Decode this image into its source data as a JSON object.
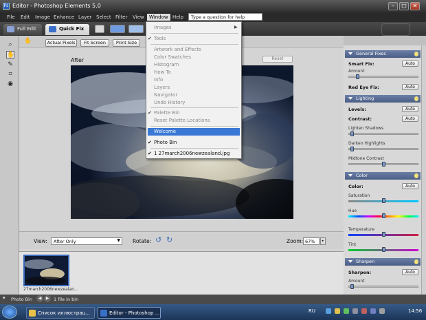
{
  "window": {
    "title": "Editor - Photoshop Elements 5.0",
    "controls": {
      "minimize": "–",
      "maximize": "□",
      "close": "✕"
    }
  },
  "menubar": {
    "items": [
      "File",
      "Edit",
      "Image",
      "Enhance",
      "Layer",
      "Select",
      "Filter",
      "View",
      "Window",
      "Help"
    ],
    "active": "Window",
    "help_placeholder": "Type a question for help"
  },
  "modes": {
    "full_edit": "Full Edit",
    "quick_fix": "Quick Fix",
    "active": "Quick Fix"
  },
  "options_bar": {
    "actual_pixels": "Actual Pixels",
    "fit_screen": "Fit Screen",
    "print_size": "Print Size"
  },
  "canvas": {
    "after_label": "After",
    "reset_label": "Reset"
  },
  "view_bar": {
    "view_label": "View:",
    "view_value": "After Only",
    "rotate_label": "Rotate:",
    "zoom_label": "Zoom:",
    "zoom_value": "67%"
  },
  "photo_bin": {
    "thumb_name": "27march2006newzealan...",
    "status_label": "Photo Bin",
    "status_count": "1 file in bin"
  },
  "window_menu": {
    "items": [
      {
        "label": "Images",
        "enabled": false,
        "checked": false,
        "submenu": true
      },
      {
        "label": "Tools",
        "enabled": false,
        "checked": true
      },
      {
        "label": "Artwork and Effects",
        "enabled": false,
        "checked": false
      },
      {
        "label": "Color Swatches",
        "enabled": false,
        "checked": false
      },
      {
        "label": "Histogram",
        "enabled": false,
        "checked": false
      },
      {
        "label": "How To",
        "enabled": false,
        "checked": false
      },
      {
        "label": "Info",
        "enabled": false,
        "checked": false
      },
      {
        "label": "Layers",
        "enabled": false,
        "checked": false
      },
      {
        "label": "Navigator",
        "enabled": false,
        "checked": false
      },
      {
        "label": "Undo History",
        "enabled": false,
        "checked": false
      },
      {
        "label": "Palette Bin",
        "enabled": false,
        "checked": true
      },
      {
        "label": "Reset Palette Locations",
        "enabled": false,
        "checked": false
      },
      {
        "label": "Welcome",
        "enabled": true,
        "checked": false,
        "highlighted": true
      },
      {
        "label": "Photo Bin",
        "enabled": true,
        "checked": true
      },
      {
        "label": "1 27march2006newzealand.jpg",
        "enabled": true,
        "checked": true
      }
    ]
  },
  "palette": {
    "general_fixes": {
      "title": "General Fixes",
      "smart_fix": "Smart Fix:",
      "amount": "Amount",
      "red_eye": "Red Eye Fix:",
      "auto": "Auto"
    },
    "lighting": {
      "title": "Lighting",
      "levels": "Levels:",
      "contrast": "Contrast:",
      "lighten_shadows": "Lighten Shadows",
      "darken_highlights": "Darken Highlights",
      "midtone_contrast": "Midtone Contrast",
      "auto": "Auto"
    },
    "color": {
      "title": "Color",
      "color": "Color:",
      "saturation": "Saturation",
      "hue": "Hue",
      "temperature": "Temperature",
      "tint": "Tint",
      "auto": "Auto"
    },
    "sharpen": {
      "title": "Sharpen",
      "sharpen": "Sharpen:",
      "amount": "Amount",
      "auto": "Auto"
    }
  },
  "taskbar": {
    "items": [
      "Список иллюстрац...",
      "Editor - Photoshop ..."
    ],
    "lang": "RU",
    "clock": "14:56"
  },
  "colors": {
    "menu_highlight": "#3a78d6",
    "palette_header": "#5a6d95",
    "quick_fix_tab": "#e6e6e6"
  }
}
